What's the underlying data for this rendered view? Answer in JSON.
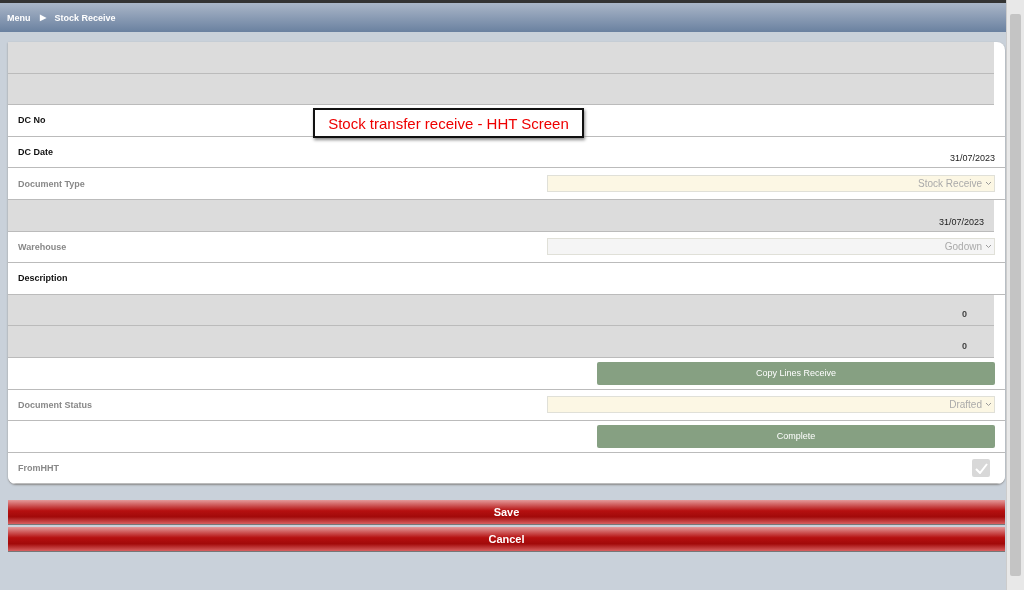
{
  "breadcrumb": {
    "menu": "Menu",
    "separator": "▶",
    "current": "Stock Receive"
  },
  "annotation": "Stock transfer receive - HHT Screen",
  "rows": [
    {
      "kind": "blank",
      "shaded": true
    },
    {
      "kind": "blank",
      "shaded": true
    },
    {
      "kind": "field",
      "label": "DC No",
      "shaded": false
    },
    {
      "kind": "field",
      "label": "DC Date",
      "value": "31/07/2023",
      "shaded": false
    },
    {
      "kind": "select",
      "label": "Document Type",
      "value": "Stock Receive",
      "disabled": true,
      "color": "#fcf7e4"
    },
    {
      "kind": "field",
      "value": "31/07/2023",
      "shaded": true
    },
    {
      "kind": "select",
      "label": "Warehouse",
      "value": "Godown",
      "disabled": true,
      "color": "#f5f5f5"
    },
    {
      "kind": "field",
      "label": "Description",
      "shaded": false
    },
    {
      "kind": "number",
      "value": "0",
      "shaded": true
    },
    {
      "kind": "number",
      "value": "0",
      "shaded": true
    },
    {
      "kind": "button",
      "text": "Copy Lines Receive"
    },
    {
      "kind": "select",
      "label": "Document Status",
      "value": "Drafted",
      "disabled": true,
      "color": "#fcf7e4"
    },
    {
      "kind": "button",
      "text": "Complete"
    },
    {
      "kind": "checkbox",
      "label": "FromHHT",
      "checked": true,
      "disabled": true
    }
  ],
  "actions": [
    "Save",
    "Cancel"
  ]
}
